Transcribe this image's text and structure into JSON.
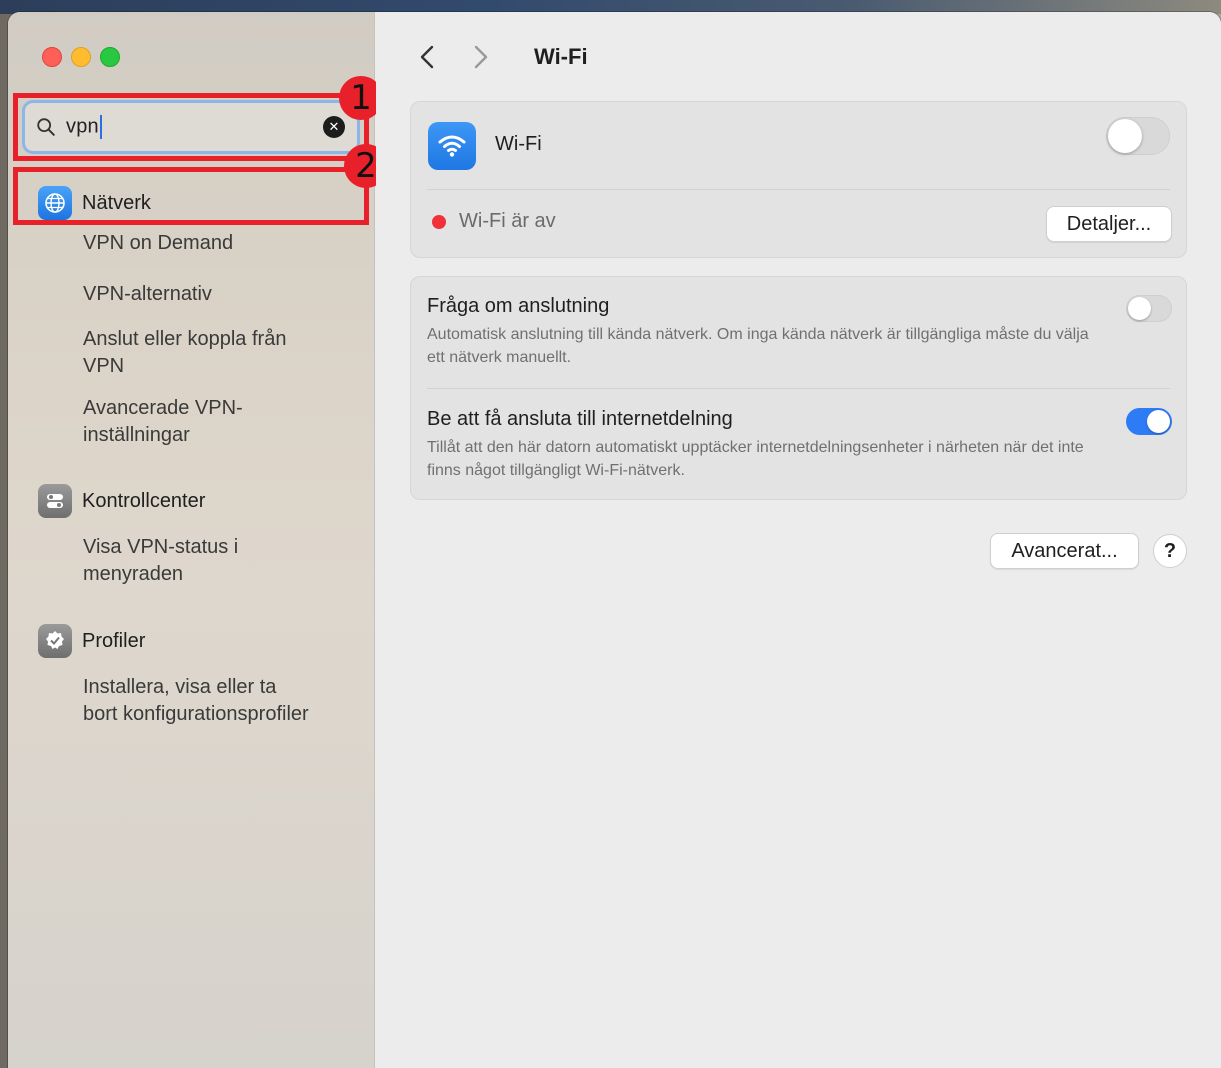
{
  "search": {
    "query": "vpn"
  },
  "annotations": {
    "one": "1",
    "two": "2"
  },
  "sidebar": {
    "groups": [
      {
        "label": "Nätverk",
        "icon": "globe-icon",
        "subitems": [
          "VPN on Demand",
          "VPN-alternativ",
          "Anslut eller koppla från VPN",
          "Avancerade VPN-inställningar"
        ]
      },
      {
        "label": "Kontrollcenter",
        "icon": "control-center-icon",
        "subitems": [
          "Visa VPN-status i menyraden"
        ]
      },
      {
        "label": "Profiler",
        "icon": "profile-badge-icon",
        "subitems": [
          "Installera, visa eller ta bort konfigurationsprofiler"
        ]
      }
    ]
  },
  "main": {
    "title": "Wi-Fi",
    "wifi_label": "Wi-Fi",
    "wifi_enabled": false,
    "status_text": "Wi-Fi är av",
    "details_button": "Detaljer...",
    "ask_join": {
      "title": "Fråga om anslutning",
      "description": "Automatisk anslutning till kända nätverk. Om inga kända nätverk är tillgängliga måste du välja ett nätverk manuellt.",
      "enabled": false
    },
    "hotspot": {
      "title": "Be att få ansluta till internetdelning",
      "description": "Tillåt att den här datorn automatiskt upptäcker internetdelningsenheter i närheten när det inte finns något tillgängligt Wi-Fi-nätverk.",
      "enabled": true
    },
    "advanced_button": "Avancerat...",
    "help_button": "?"
  },
  "colors": {
    "accent": "#2d7cf6",
    "annotation": "#e8202a",
    "status_off": "#f0313a"
  }
}
